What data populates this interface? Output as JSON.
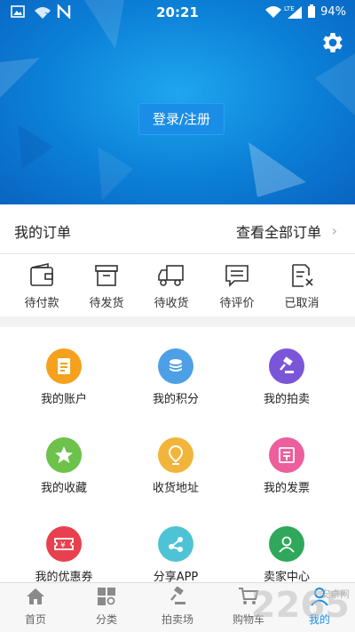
{
  "status_bar": {
    "time": "20:21",
    "battery": "94%"
  },
  "header": {
    "login_label": "登录/注册"
  },
  "orders": {
    "title": "我的订单",
    "view_all": "查看全部订单",
    "items": [
      {
        "label": "待付款",
        "icon": "wallet-icon"
      },
      {
        "label": "待发货",
        "icon": "box-icon"
      },
      {
        "label": "待收货",
        "icon": "truck-icon"
      },
      {
        "label": "待评价",
        "icon": "comment-icon"
      },
      {
        "label": "已取消",
        "icon": "cancel-doc-icon"
      }
    ]
  },
  "services": [
    {
      "label": "我的账户",
      "icon": "account-icon",
      "color": "#f5a11e"
    },
    {
      "label": "我的积分",
      "icon": "coins-icon",
      "color": "#4ea0e6"
    },
    {
      "label": "我的拍卖",
      "icon": "gavel-icon",
      "color": "#7b55d8"
    },
    {
      "label": "我的收藏",
      "icon": "star-icon",
      "color": "#6cc24a"
    },
    {
      "label": "收货地址",
      "icon": "location-icon",
      "color": "#f2b53b"
    },
    {
      "label": "我的发票",
      "icon": "invoice-icon",
      "color": "#ec5f9c"
    },
    {
      "label": "我的优惠券",
      "icon": "coupon-icon",
      "color": "#e8404f"
    },
    {
      "label": "分享APP",
      "icon": "share-icon",
      "color": "#4fc3d6"
    },
    {
      "label": "卖家中心",
      "icon": "seller-icon",
      "color": "#2fa85b"
    }
  ],
  "tabbar": {
    "items": [
      {
        "label": "首页",
        "icon": "home-icon"
      },
      {
        "label": "分类",
        "icon": "category-icon"
      },
      {
        "label": "拍卖场",
        "icon": "auction-icon"
      },
      {
        "label": "购物车",
        "icon": "cart-icon"
      },
      {
        "label": "我的",
        "icon": "profile-icon"
      }
    ],
    "active": "我的"
  },
  "watermark": {
    "text": "2265",
    "sub": "安卓网"
  },
  "colors": {
    "accent": "#1a8ee6",
    "header_bg": "#0b7fd6"
  }
}
